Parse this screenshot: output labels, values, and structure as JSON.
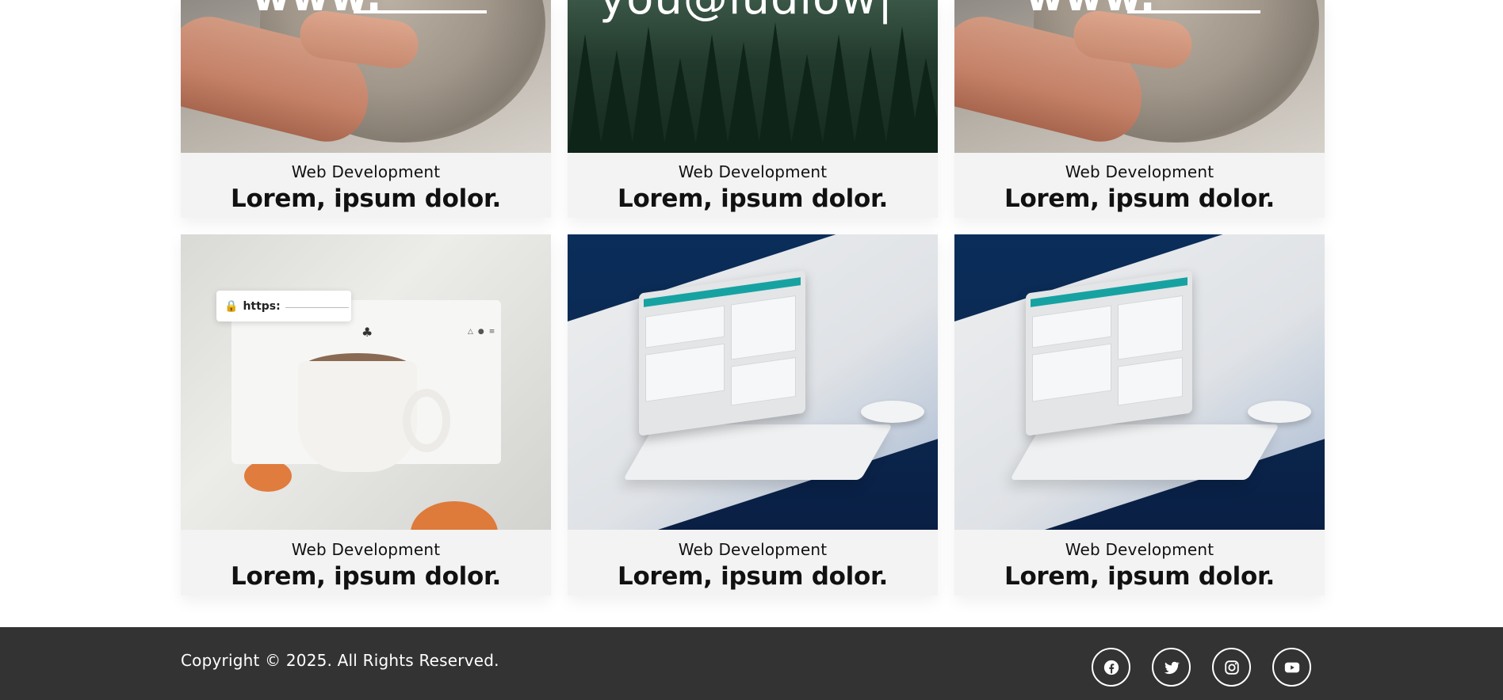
{
  "portfolio": {
    "items": [
      {
        "category": "Web Development",
        "title": "Lorem, ipsum dolor.",
        "image": "pottery-wheel-hands",
        "overlay_text": "www."
      },
      {
        "category": "Web Development",
        "title": "Lorem, ipsum dolor.",
        "image": "pine-forest",
        "overlay_text": "you@ludlow|"
      },
      {
        "category": "Web Development",
        "title": "Lorem, ipsum dolor.",
        "image": "pottery-wheel-hands",
        "overlay_text": "www."
      },
      {
        "category": "Web Development",
        "title": "Lorem, ipsum dolor.",
        "image": "coffee-mug-browser-mockup",
        "url_label": "https:"
      },
      {
        "category": "Web Development",
        "title": "Lorem, ipsum dolor.",
        "image": "laptop-dashboard-mockup"
      },
      {
        "category": "Web Development",
        "title": "Lorem, ipsum dolor.",
        "image": "laptop-dashboard-mockup"
      }
    ]
  },
  "footer": {
    "copyright": "Copyright © 2025. All Rights Reserved.",
    "social_links": [
      {
        "name": "facebook",
        "icon": "facebook-icon"
      },
      {
        "name": "twitter",
        "icon": "twitter-icon"
      },
      {
        "name": "instagram",
        "icon": "instagram-icon"
      },
      {
        "name": "youtube",
        "icon": "youtube-icon"
      }
    ]
  },
  "colors": {
    "card_background": "#f3f3f3",
    "footer_background": "#333333",
    "footer_text": "#ffffff",
    "accent_teal": "#17a2a2"
  }
}
